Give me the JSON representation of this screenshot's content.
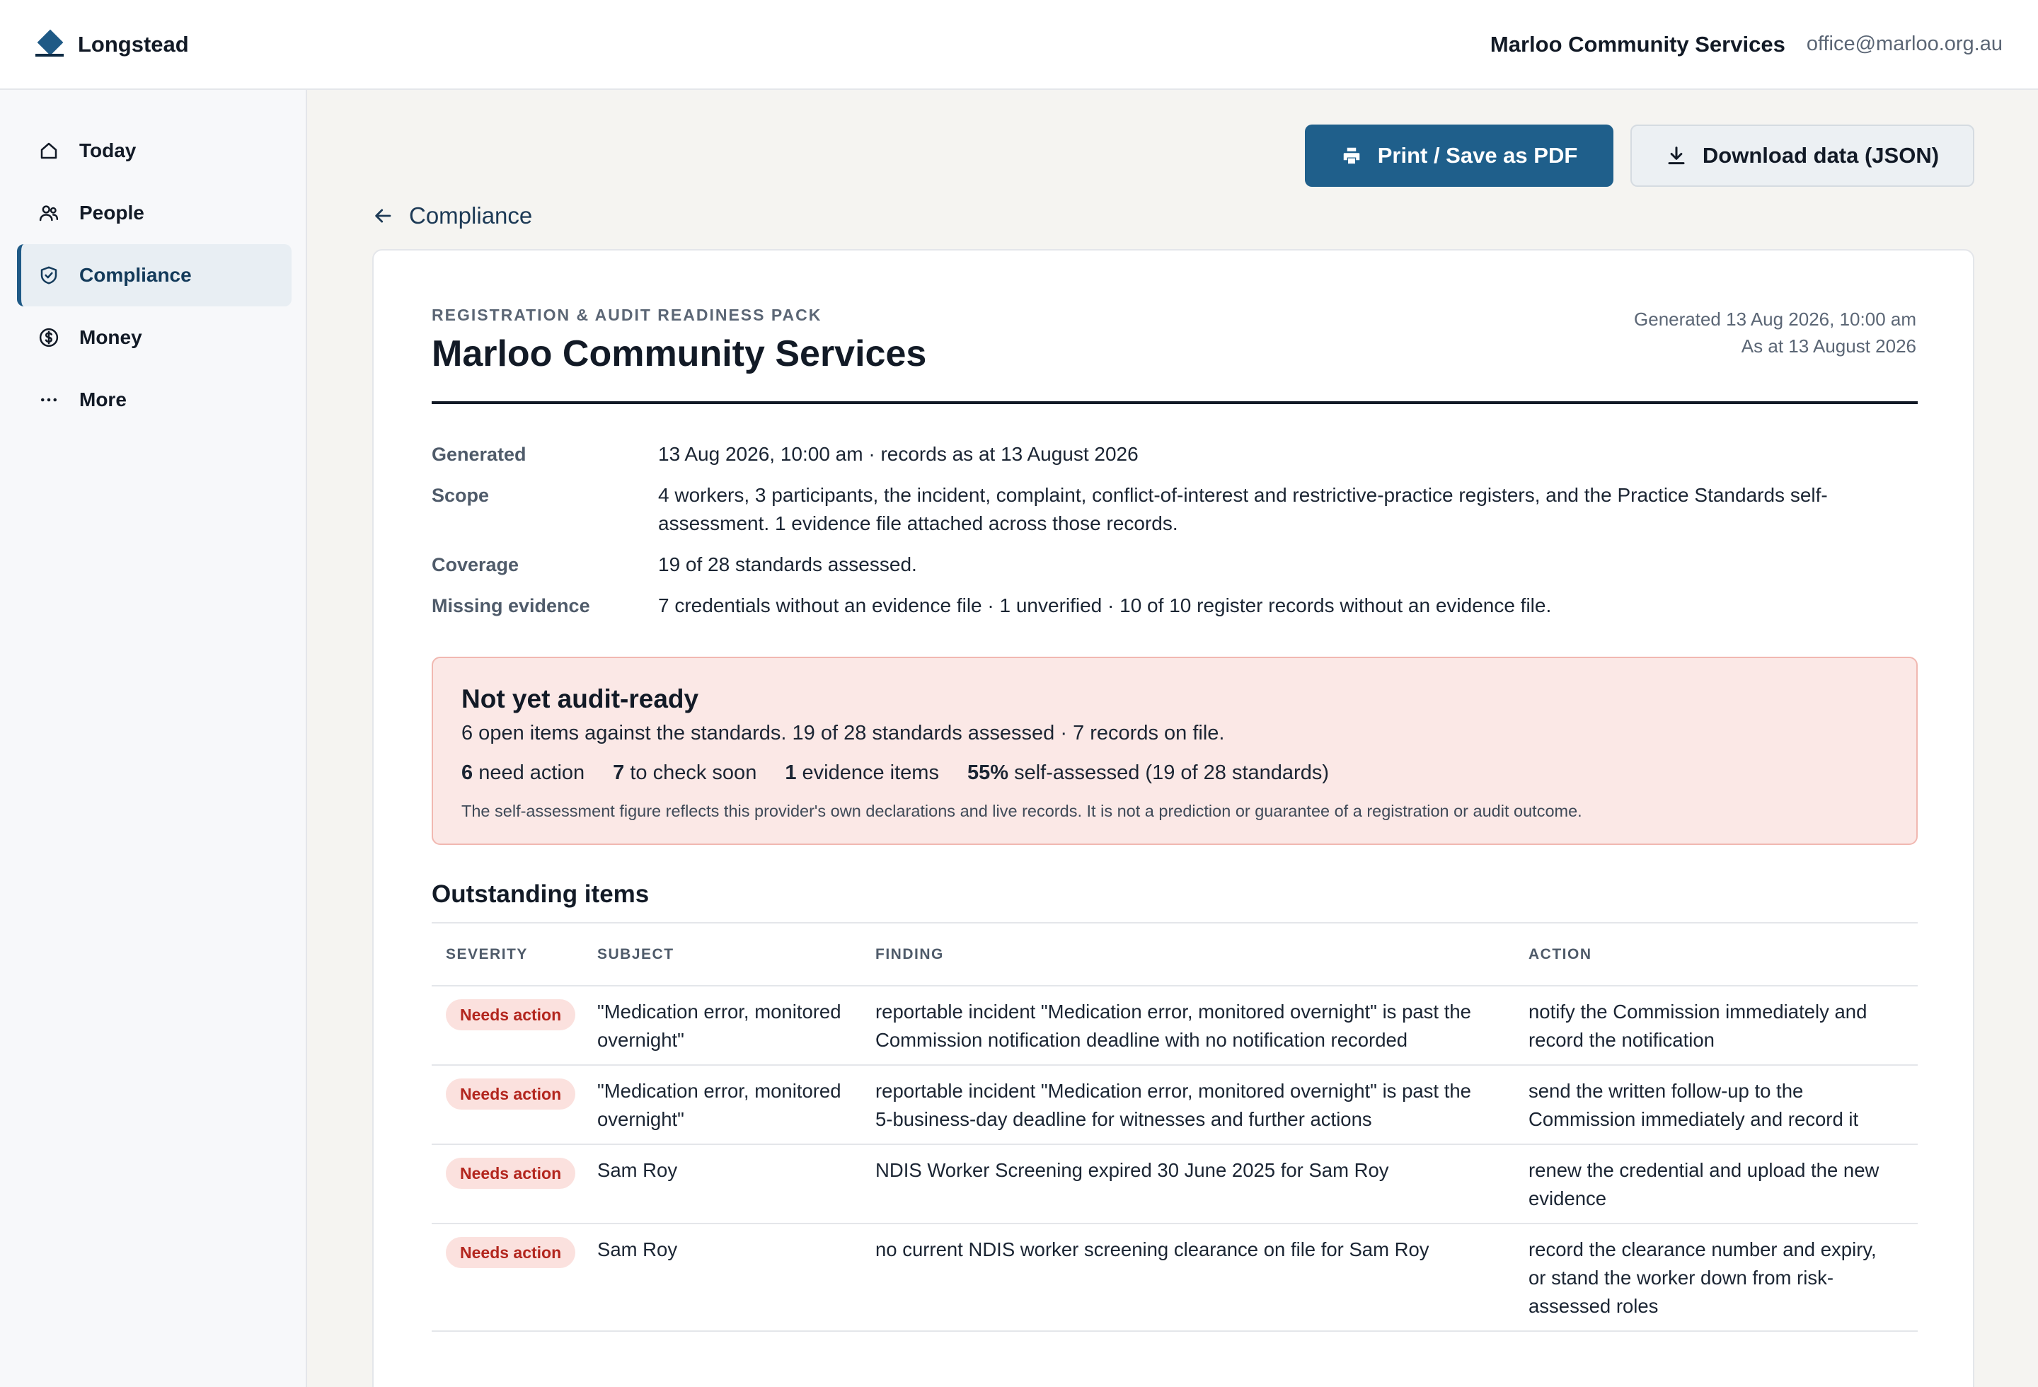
{
  "app": {
    "brand_name": "Longstead",
    "org_name": "Marloo Community Services",
    "org_email": "office@marloo.org.au"
  },
  "sidebar": {
    "items": [
      {
        "label": "Today",
        "icon": "home-icon"
      },
      {
        "label": "People",
        "icon": "people-icon"
      },
      {
        "label": "Compliance",
        "icon": "shield-check-icon",
        "active": true
      },
      {
        "label": "Money",
        "icon": "dollar-circle-icon"
      },
      {
        "label": "More",
        "icon": "more-dots-icon"
      }
    ]
  },
  "toolbar": {
    "print_label": "Print / Save as PDF",
    "download_label": "Download data (JSON)",
    "back_label": "Compliance"
  },
  "report": {
    "eyebrow": "REGISTRATION & AUDIT READINESS PACK",
    "title": "Marloo Community Services",
    "generated_line": "Generated 13 Aug 2026, 10:00 am",
    "as_at_line": "As at 13 August 2026",
    "meta": [
      {
        "key": "Generated",
        "value": "13 Aug 2026, 10:00 am · records as at 13 August 2026"
      },
      {
        "key": "Scope",
        "value": "4 workers, 3 participants, the incident, complaint, conflict-of-interest and restrictive-practice registers, and the Practice Standards self-assessment. 1 evidence file attached across those records."
      },
      {
        "key": "Coverage",
        "value": "19 of 28 standards assessed."
      },
      {
        "key": "Missing evidence",
        "value": "7 credentials without an evidence file · 1 unverified · 10 of 10 register records without an evidence file."
      }
    ]
  },
  "status": {
    "title": "Not yet audit-ready",
    "subtitle": "6 open items against the standards. 19 of 28 standards assessed · 7 records on file.",
    "stats": [
      {
        "num": "6",
        "label": "need action"
      },
      {
        "num": "7",
        "label": "to check soon"
      },
      {
        "num": "1",
        "label": "evidence items"
      },
      {
        "num": "55%",
        "label": "self-assessed (19 of 28 standards)"
      }
    ],
    "note": "The self-assessment figure reflects this provider's own declarations and live records. It is not a prediction or guarantee of a registration or audit outcome.",
    "color": "#fbe8e6"
  },
  "outstanding": {
    "title": "Outstanding items",
    "columns": [
      "SEVERITY",
      "SUBJECT",
      "FINDING",
      "ACTION"
    ],
    "rows": [
      {
        "severity": "Needs action",
        "subject": "\"Medication error, monitored overnight\"",
        "finding": "reportable incident \"Medication error, monitored overnight\" is past the Commission notification deadline with no notification recorded",
        "action": "notify the Commission immediately and record the notification"
      },
      {
        "severity": "Needs action",
        "subject": "\"Medication error, monitored overnight\"",
        "finding": "reportable incident \"Medication error, monitored overnight\" is past the 5-business-day deadline for witnesses and further actions",
        "action": "send the written follow-up to the Commission immediately and record it"
      },
      {
        "severity": "Needs action",
        "subject": "Sam Roy",
        "finding": "NDIS Worker Screening expired 30 June 2025 for Sam Roy",
        "action": "renew the credential and upload the new evidence"
      },
      {
        "severity": "Needs action",
        "subject": "Sam Roy",
        "finding": "no current NDIS worker screening clearance on file for Sam Roy",
        "action": "record the clearance number and expiry, or stand the worker down from risk-assessed roles"
      }
    ]
  },
  "colors": {
    "accent": "#1f5f8b",
    "danger_text": "#b3261e",
    "danger_bg": "#fbe1de"
  }
}
